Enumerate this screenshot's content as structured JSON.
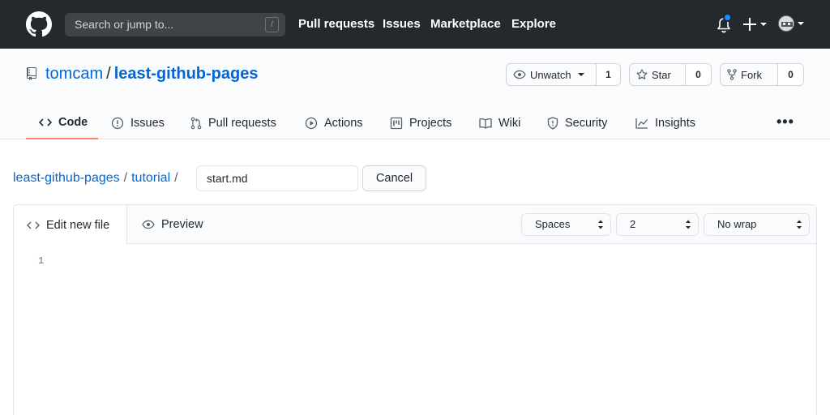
{
  "header": {
    "search_placeholder": "Search or jump to...",
    "search_shortcut": "/",
    "nav": [
      "Pull requests",
      "Issues",
      "Marketplace",
      "Explore"
    ]
  },
  "repo": {
    "owner": "tomcam",
    "separator": "/",
    "name": "least-github-pages",
    "watch_label": "Unwatch",
    "watch_count": "1",
    "star_label": "Star",
    "star_count": "0",
    "fork_label": "Fork",
    "fork_count": "0"
  },
  "tabs": [
    {
      "label": "Code",
      "icon": "code-icon",
      "selected": true
    },
    {
      "label": "Issues",
      "icon": "issue-icon"
    },
    {
      "label": "Pull requests",
      "icon": "pull-request-icon"
    },
    {
      "label": "Actions",
      "icon": "play-icon"
    },
    {
      "label": "Projects",
      "icon": "project-icon"
    },
    {
      "label": "Wiki",
      "icon": "book-icon"
    },
    {
      "label": "Security",
      "icon": "shield-icon"
    },
    {
      "label": "Insights",
      "icon": "graph-icon"
    }
  ],
  "more_label": "•••",
  "breadcrumb": {
    "repo": "least-github-pages",
    "folder": "tutorial",
    "separator": "/",
    "filename": "start.md"
  },
  "cancel_label": "Cancel",
  "editor": {
    "edit_tab": "Edit new file",
    "preview_tab": "Preview",
    "indent_mode": "Spaces",
    "indent_size": "2",
    "wrap_mode": "No wrap",
    "line_number": "1"
  },
  "colors": {
    "header_bg": "#24292e",
    "link": "#0366d6",
    "selected_tab_border": "#f9826c",
    "notification_dot": "#2188ff"
  }
}
